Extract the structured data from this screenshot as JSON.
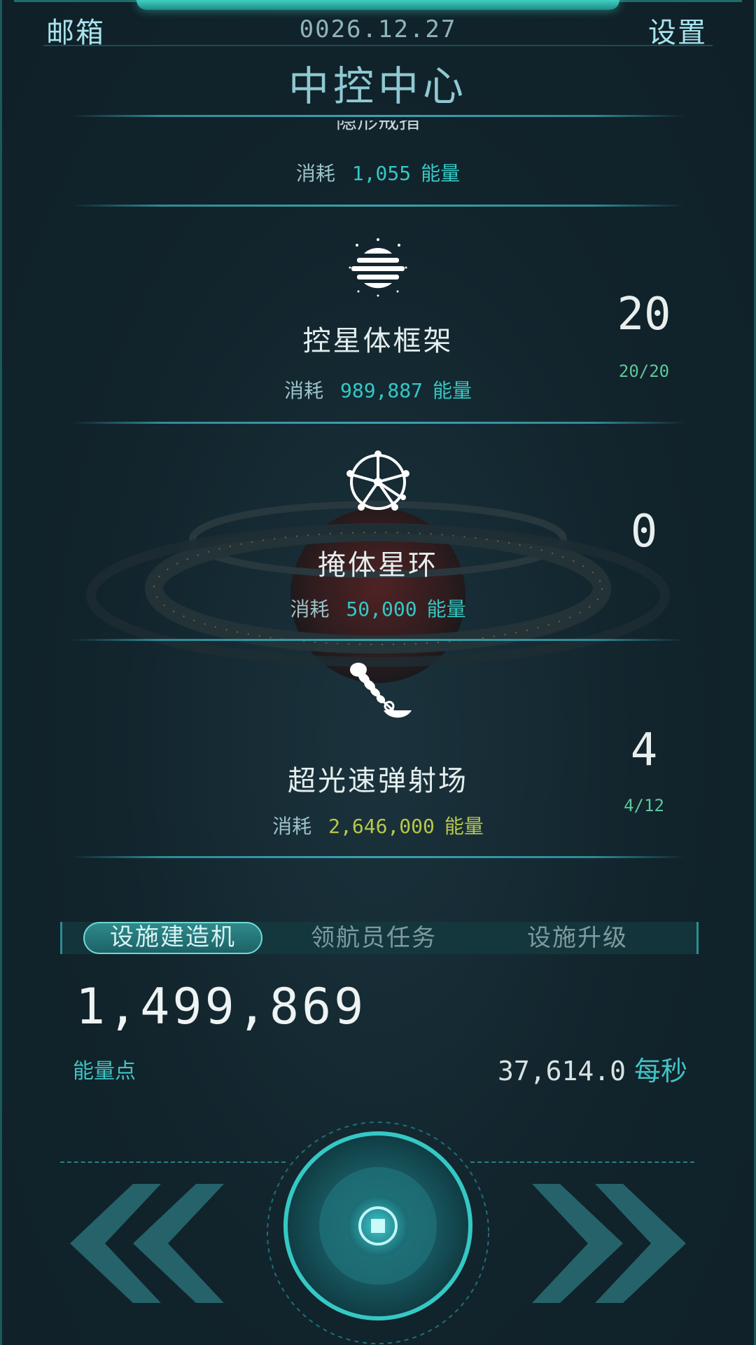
{
  "header": {
    "mailbox_label": "邮箱",
    "date": "0026.12.27",
    "settings_label": "设置",
    "title": "中控中心"
  },
  "top_item": {
    "cut_name": "隐形戒指",
    "cost_prefix": "消耗",
    "cost_value": "1,055",
    "cost_unit": "能量"
  },
  "items": [
    {
      "icon": "dyson-frame-icon",
      "name": "控星体框架",
      "cost_prefix": "消耗",
      "cost_value": "989,887",
      "cost_unit": "能量",
      "count": "20",
      "progress": "20/20"
    },
    {
      "icon": "ring-wheel-icon",
      "name": "掩体星环",
      "cost_prefix": "消耗",
      "cost_value": "50,000",
      "cost_unit": "能量",
      "count": "0",
      "progress": ""
    },
    {
      "icon": "railgun-icon",
      "name": "超光速弹射场",
      "cost_prefix": "消耗",
      "cost_value": "2,646,000",
      "cost_unit": "能量",
      "count": "4",
      "progress": "4/12"
    }
  ],
  "tabs": [
    {
      "label": "设施建造机",
      "active": true
    },
    {
      "label": "领航员任务",
      "active": false
    },
    {
      "label": "设施升级",
      "active": false
    }
  ],
  "energy": {
    "amount": "1,499,869",
    "label": "能量点",
    "rate_value": "37,614.0",
    "rate_unit": "每秒"
  },
  "controls": {
    "prev_icon": "double-chevron-left-icon",
    "next_icon": "double-chevron-right-icon",
    "center_icon": "core-button-icon"
  },
  "colors": {
    "accent": "#35c8c4",
    "unaffordable": "#b8c84a",
    "progress": "#5ec79a",
    "background": "#12242c"
  }
}
